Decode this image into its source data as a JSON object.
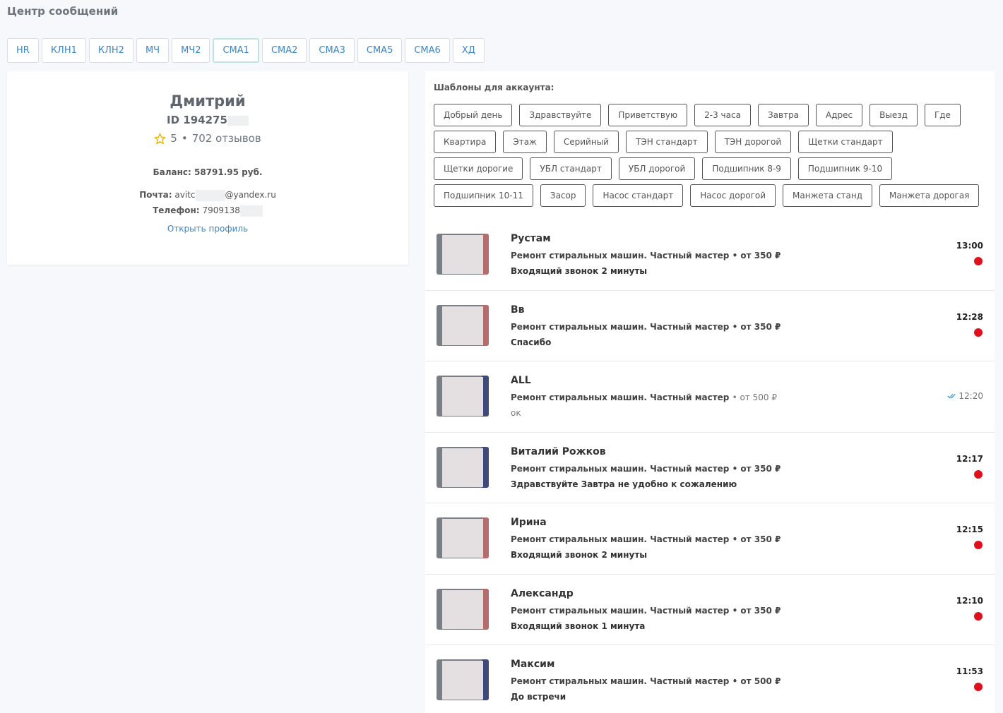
{
  "page": {
    "title": "Центр сообщений"
  },
  "tabs": [
    {
      "label": "HR"
    },
    {
      "label": "КЛН1"
    },
    {
      "label": "КЛН2"
    },
    {
      "label": "МЧ"
    },
    {
      "label": "МЧ2"
    },
    {
      "label": "СМА1",
      "active": true
    },
    {
      "label": "СМА2"
    },
    {
      "label": "СМА3"
    },
    {
      "label": "СМА5"
    },
    {
      "label": "СМА6"
    },
    {
      "label": "ХД"
    }
  ],
  "profile": {
    "name": "Дмитрий",
    "id_label": "ID 194275",
    "rating": "5",
    "reviews": "702 отзывов",
    "balance_label": "Баланс: 58791.95 руб.",
    "email_label": "Почта:",
    "email_prefix": "avitc",
    "email_suffix": "@yandex.ru",
    "phone_label": "Телефон:",
    "phone_value": "7909138",
    "open_profile": "Открыть профиль",
    "star_color": "#f0b400"
  },
  "templates": {
    "title": "Шаблоны для аккаунта:",
    "items": [
      "Добрый день",
      "Здравствуйте",
      "Приветствую",
      "2-3 часа",
      "Завтра",
      "Адрес",
      "Выезд",
      "Где",
      "Квартира",
      "Этаж",
      "Серийный",
      "ТЭН стандарт",
      "ТЭН дорогой",
      "Щетки стандарт",
      "Щетки дорогие",
      "УБЛ стандарт",
      "УБЛ дорогой",
      "Подшипник 8-9",
      "Подшипник 9-10",
      "Подшипник 10-11",
      "Засор",
      "Насос стандарт",
      "Насос дорогой",
      "Манжета станд",
      "Манжета дорогая"
    ]
  },
  "chats": [
    {
      "name": "Рустам",
      "ad": "Ремонт стиральных машин. Частный мастер • от 350 ₽",
      "message": "Входящий звонок 2 минуты",
      "time": "13:00",
      "unread": true,
      "stripe": "red"
    },
    {
      "name": "Вв",
      "ad": "Ремонт стиральных машин. Частный мастер • от 350 ₽",
      "message": "Спасибо",
      "time": "12:28",
      "unread": true,
      "stripe": "red"
    },
    {
      "name": "ALL",
      "ad_main": "Ремонт стиральных машин. Частный мастер",
      "ad_price": "• от 500 ₽",
      "message": "ок",
      "time": "12:20",
      "unread": false,
      "stripe": "blue"
    },
    {
      "name": "Виталий Рожков",
      "ad": "Ремонт стиральных машин. Частный мастер • от 350 ₽",
      "message": "Здравствуйте Завтра не удобно к сожалению",
      "time": "12:17",
      "unread": true,
      "stripe": "blue"
    },
    {
      "name": "Ирина",
      "ad": "Ремонт стиральных машин. Частный мастер • от 350 ₽",
      "message": "Входящий звонок 2 минуты",
      "time": "12:15",
      "unread": true,
      "stripe": "red"
    },
    {
      "name": "Александр",
      "ad": "Ремонт стиральных машин. Частный мастер • от 350 ₽",
      "message": "Входящий звонок 1 минута",
      "time": "12:10",
      "unread": true,
      "stripe": "red"
    },
    {
      "name": "Максим",
      "ad": "Ремонт стиральных машин. Частный мастер • от 500 ₽",
      "message": "До встречи",
      "time": "11:53",
      "unread": true,
      "stripe": "blue"
    }
  ],
  "colors": {
    "accent": "#3a86c8",
    "unread": "#e0101c",
    "read_check": "#3a9ad9"
  }
}
